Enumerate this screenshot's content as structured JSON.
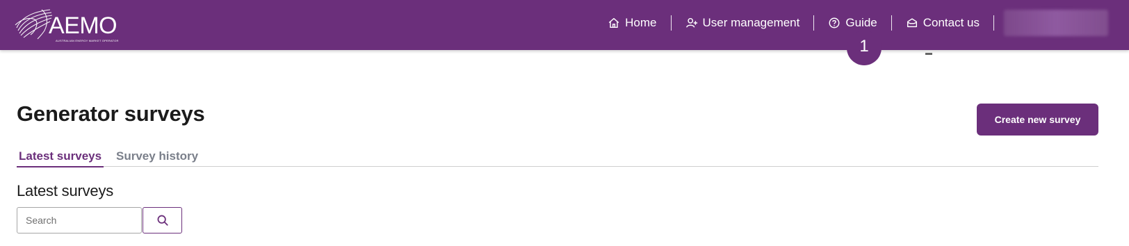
{
  "header": {
    "brand": "AEMO",
    "brand_subtitle": "AUSTRALIAN ENERGY MARKET OPERATOR",
    "nav": {
      "home": "Home",
      "user_management": "User management",
      "guide": "Guide",
      "contact_us": "Contact us"
    },
    "icons": {
      "home": "home-icon",
      "user_management": "user-add-icon",
      "guide": "help-circle-icon",
      "contact_us": "inbox-icon"
    }
  },
  "step_badge": "1",
  "main": {
    "title": "Generator surveys",
    "create_button": "Create new survey",
    "tabs": [
      {
        "label": "Latest surveys",
        "active": true
      },
      {
        "label": "Survey history",
        "active": false
      }
    ],
    "section_title": "Latest surveys",
    "search": {
      "placeholder": "Search",
      "value": ""
    }
  },
  "colors": {
    "brand_purple": "#6b2f7b",
    "tab_inactive": "#7a7f8a"
  }
}
